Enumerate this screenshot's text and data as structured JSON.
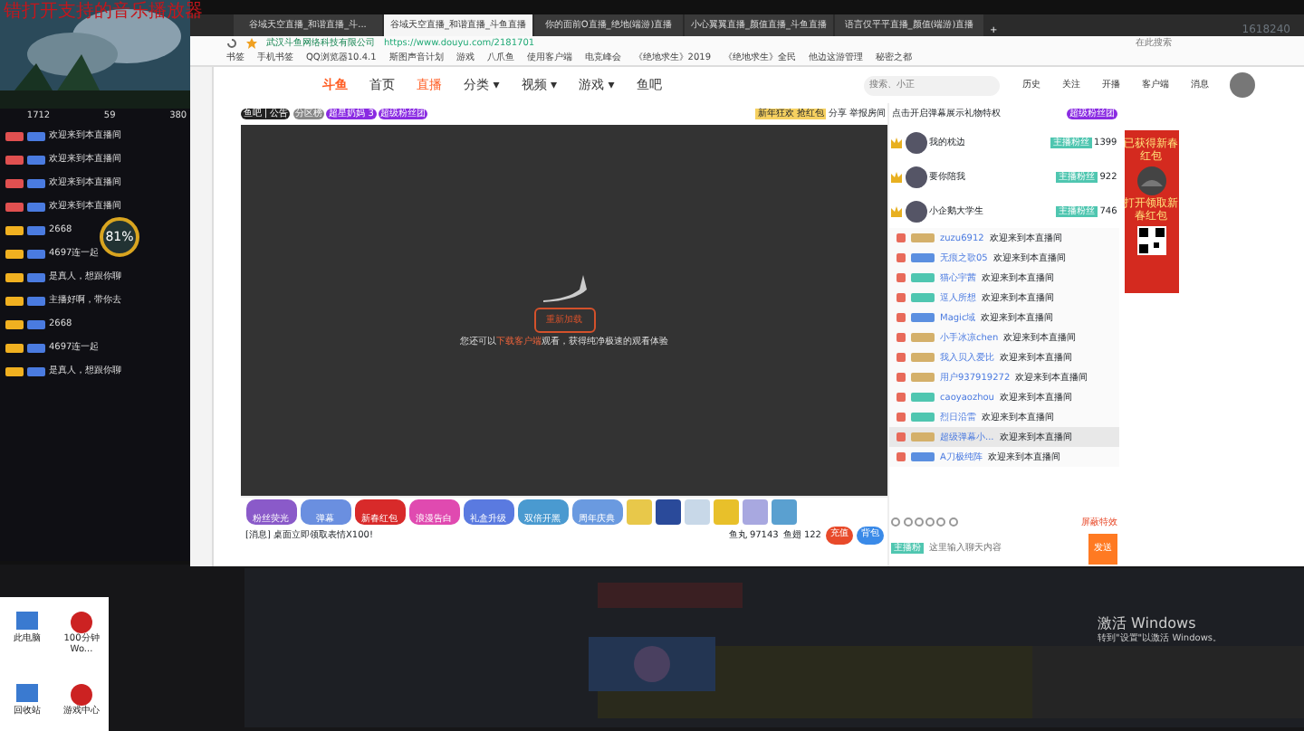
{
  "overlay_title": "错打开支持的音乐播放器",
  "left_panel": {
    "stats": [
      "1712",
      "59",
      "380"
    ],
    "messages": [
      {
        "text": "欢迎来到本直播间",
        "color": "#e05050"
      },
      {
        "text": "欢迎来到本直播间",
        "color": "#e05050"
      },
      {
        "text": "欢迎来到本直播间",
        "color": "#e05050"
      },
      {
        "text": "欢迎来到本直播间",
        "color": "#e05050"
      },
      {
        "text": "2668",
        "color": "#f0b020"
      },
      {
        "text": "4697连一起",
        "color": "#f0b020"
      },
      {
        "text": "是真人，想跟你聊",
        "color": "#f0b020"
      },
      {
        "text": "主播好啊，带你去",
        "color": "#f0b020"
      },
      {
        "text": "2668",
        "color": "#f0b020"
      },
      {
        "text": "4697连一起",
        "color": "#f0b020"
      },
      {
        "text": "是真人，想跟你聊",
        "color": "#f0b020"
      }
    ],
    "gauge": "81%"
  },
  "browser": {
    "tabs": [
      {
        "title": "谷域天空直播_和谐直播_斗...",
        "selected": false
      },
      {
        "title": "谷域天空直播_和谐直播_斗鱼直播",
        "selected": true
      },
      {
        "title": "你的面前O直播_绝地(端游)直播",
        "selected": false
      },
      {
        "title": "小心翼翼直播_颜值直播_斗鱼直播",
        "selected": false
      },
      {
        "title": "语言仅平平直播_颜值(端游)直播",
        "selected": false
      }
    ],
    "new_tab": "+",
    "site_owner": "武汉斗鱼网络科技有限公司",
    "url": "https://www.douyu.com/2181701",
    "search_placeholder": "在此搜索",
    "bookmarks": [
      "书签",
      "手机书签",
      "QQ浏览器10.4.1",
      "斯图声音计划",
      "游戏",
      "八爪鱼",
      "使用客户端",
      "电竞峰会",
      "《绝地求生》2019",
      "《绝地求生》全民",
      "他边这游管理",
      "秘密之都"
    ],
    "watermark_id": "1618240"
  },
  "site": {
    "logo": "斗鱼",
    "nav": [
      {
        "label": "首页",
        "selected": false
      },
      {
        "label": "直播",
        "selected": true
      },
      {
        "label": "分类 ▾",
        "selected": false
      },
      {
        "label": "视频 ▾",
        "selected": false
      },
      {
        "label": "游戏 ▾",
        "selected": false
      },
      {
        "label": "鱼吧",
        "selected": false
      }
    ],
    "search_placeholder": "搜索、小正",
    "header_icons": [
      "历史",
      "关注",
      "开播",
      "客户端",
      "消息"
    ]
  },
  "room": {
    "tags": [
      "鱼吧 | 公告",
      "分区榜",
      "超星奶妈 3",
      "超级粉丝团"
    ],
    "share": "分享",
    "report": "举报房间",
    "promo": "新年狂欢 抢红包",
    "reload": "重新加载",
    "notice_pre": "您还可以",
    "notice_link": "下载客户端",
    "notice_post": "观看，获得纯净极速的观看体验",
    "gifts": [
      "粉丝荧光",
      "弹幕",
      "新春红包",
      "浪漫告白",
      "礼盒升级",
      "双倍开黑",
      "周年庆典"
    ],
    "message": "[消息] 桌面立即领取表情X100!",
    "fish_balls": "鱼丸 97143",
    "fish_fins": "鱼翅 122",
    "recharge": "充值",
    "backpack": "背包"
  },
  "chat": {
    "header": "点击开启弹幕展示礼物特权",
    "vip": "超级粉丝团",
    "ranks": [
      {
        "name": "我的枕边",
        "score": "1399",
        "badge": "主播粉丝"
      },
      {
        "name": "要你陪我",
        "score": "922",
        "badge": "主播粉丝"
      },
      {
        "name": "小企鹅大学生",
        "score": "746",
        "badge": "主播粉丝"
      }
    ],
    "messages": [
      {
        "user": "zuzu6912",
        "text": "欢迎来到本直播间",
        "color": "#d4b06a",
        "highlight": false
      },
      {
        "user": "无痕之歌05",
        "text": "欢迎来到本直播间",
        "color": "#5b8fe0",
        "highlight": false
      },
      {
        "user": "猫心宇茜",
        "text": "欢迎来到本直播间",
        "color": "#4fc6b0",
        "highlight": false
      },
      {
        "user": "逗人所想",
        "text": "欢迎来到本直播间",
        "color": "#4fc6b0",
        "highlight": false
      },
      {
        "user": "Magic域",
        "text": "欢迎来到本直播间",
        "color": "#5b8fe0",
        "highlight": false
      },
      {
        "user": "小手冰凉chen",
        "text": "欢迎来到本直播间",
        "color": "#d4b06a",
        "highlight": false
      },
      {
        "user": "我入贝入爱比",
        "text": "欢迎来到本直播间",
        "color": "#d4b06a",
        "highlight": false
      },
      {
        "user": "用户937919272",
        "text": "欢迎来到本直播间",
        "color": "#d4b06a",
        "highlight": false
      },
      {
        "user": "caoyaozhou",
        "text": "欢迎来到本直播间",
        "color": "#4fc6b0",
        "highlight": false
      },
      {
        "user": "烈日沿雷",
        "text": "欢迎来到本直播间",
        "color": "#4fc6b0",
        "highlight": false
      },
      {
        "user": "超级弹幕小...",
        "text": "欢迎来到本直播间",
        "color": "#d4b06a",
        "highlight": true
      },
      {
        "user": "A刀极纯阵",
        "text": "欢迎来到本直播间",
        "color": "#5b8fe0",
        "highlight": false
      }
    ],
    "block": "屏蔽特效",
    "input_placeholder": "这里输入聊天内容",
    "send": "发送",
    "badge_tag": "主播粉"
  },
  "ad": {
    "title": "已获得新春红包",
    "cta": "打开领取新春红包"
  },
  "desktop": {
    "icons": [
      "此电脑",
      "100分钟Wo...",
      "回收站",
      "游戏中心"
    ],
    "activation_title": "激活 Windows",
    "activation_hint": "转到\"设置\"以激活 Windows。"
  }
}
